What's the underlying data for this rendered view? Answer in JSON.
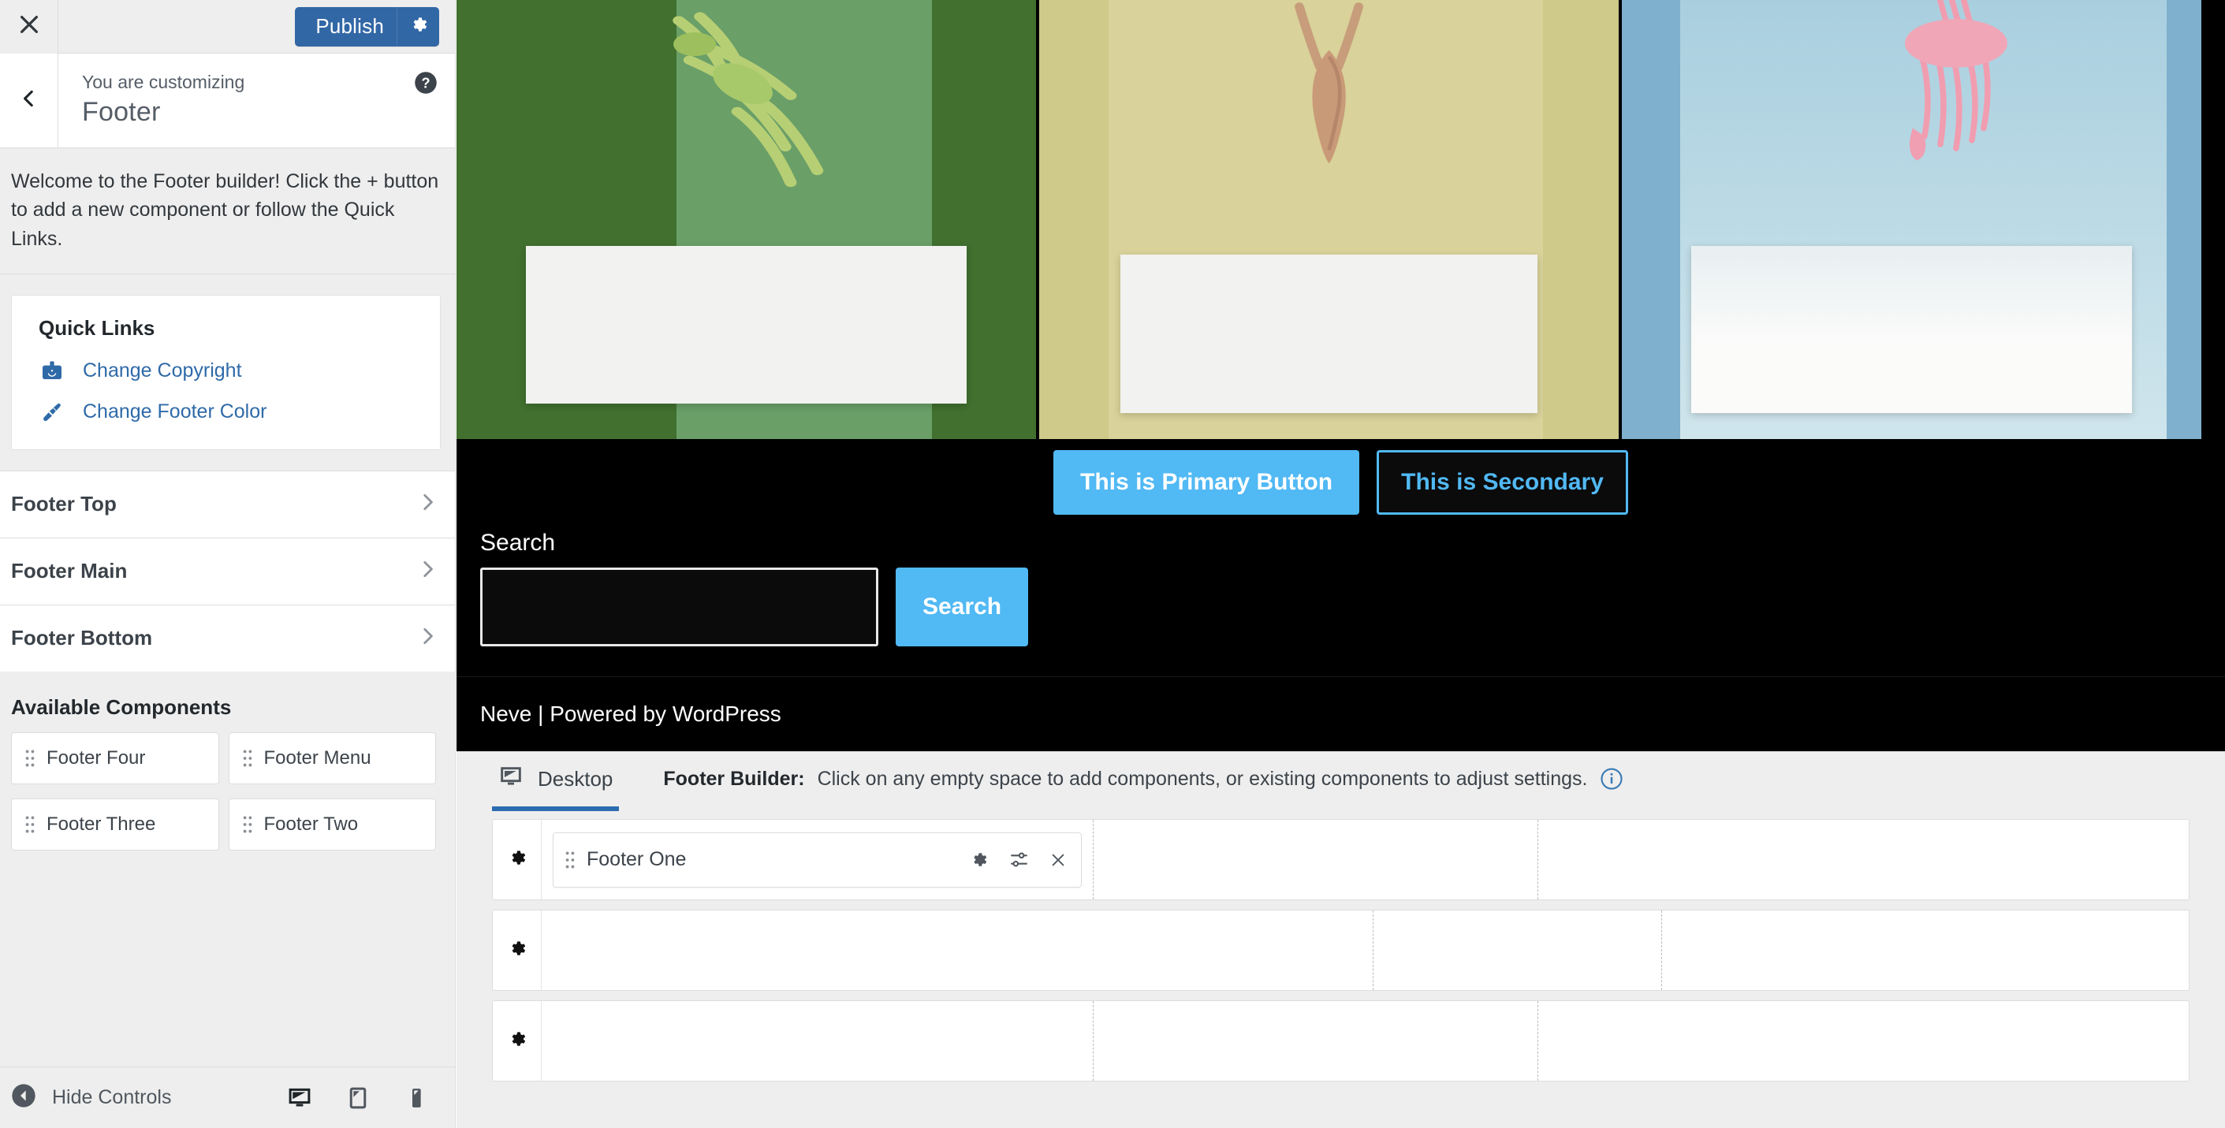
{
  "sidebar": {
    "close_icon": "close-icon",
    "publish": {
      "label": "Publish",
      "icon": "gear-icon",
      "color": "#3267a5"
    },
    "header": {
      "back_icon": "chevron-left-icon",
      "eyebrow": "You are customizing",
      "title": "Footer",
      "help_icon": "help-icon"
    },
    "intro": "Welcome to the Footer builder! Click the + button to add a new component or follow the Quick Links.",
    "quick_links": {
      "title": "Quick Links",
      "items": [
        {
          "label": "Change Copyright",
          "icon": "id-badge-icon"
        },
        {
          "label": "Change Footer Color",
          "icon": "paint-brush-icon"
        }
      ],
      "link_color": "#2f6aa8"
    },
    "sections": [
      {
        "label": "Footer Top"
      },
      {
        "label": "Footer Main"
      },
      {
        "label": "Footer Bottom"
      }
    ],
    "available": {
      "title": "Available Components",
      "items": [
        {
          "label": "Footer Four"
        },
        {
          "label": "Footer Menu"
        },
        {
          "label": "Footer Three"
        },
        {
          "label": "Footer Two"
        }
      ]
    },
    "footer_bar": {
      "hide_label": "Hide Controls",
      "hide_icon": "collapse-left-icon",
      "devices": [
        {
          "name": "desktop-icon"
        },
        {
          "name": "tablet-icon"
        },
        {
          "name": "mobile-icon"
        }
      ]
    }
  },
  "preview": {
    "images": [
      {
        "alt": "grasshopper-on-green",
        "bg": "#41702f"
      },
      {
        "alt": "antelope-head-on-olive",
        "bg": "#cfc98a"
      },
      {
        "alt": "pink-flamingo-on-blue",
        "bg": "#7fb0cd"
      }
    ],
    "buttons": {
      "primary_label": "This is Primary Button",
      "secondary_label": "This is Secondary",
      "accent": "#51b9f4"
    },
    "search": {
      "label": "Search",
      "value": "",
      "placeholder": "",
      "button_label": "Search"
    },
    "collapse_toggle_icon": "chevron-right-icon",
    "credits": "Neve | Powered by WordPress"
  },
  "builder": {
    "device_tab": {
      "label": "Desktop",
      "icon": "desktop-icon"
    },
    "hint": {
      "strong": "Footer Builder:",
      "text": "Click on any empty space to add components, or existing components to adjust settings.",
      "info_icon": "info-icon"
    },
    "rows": [
      {
        "gear_icon": "gear-icon",
        "columns": [
          {
            "width": 33.5,
            "component": {
              "label": "Footer One",
              "grip_icon": "drag-grip-icon",
              "actions": [
                "gear-icon",
                "sliders-icon",
                "close-icon"
              ]
            }
          },
          {
            "width": 27.0,
            "component": null
          },
          {
            "width": 39.5,
            "component": null
          }
        ]
      },
      {
        "gear_icon": "gear-icon",
        "columns": [
          {
            "width": 50.5,
            "component": null
          },
          {
            "width": 17.5,
            "component": null
          },
          {
            "width": 32.0,
            "component": null
          }
        ]
      },
      {
        "gear_icon": "gear-icon",
        "columns": [
          {
            "width": 33.5,
            "component": null
          },
          {
            "width": 27.0,
            "component": null
          },
          {
            "width": 39.5,
            "component": null
          }
        ]
      }
    ]
  }
}
